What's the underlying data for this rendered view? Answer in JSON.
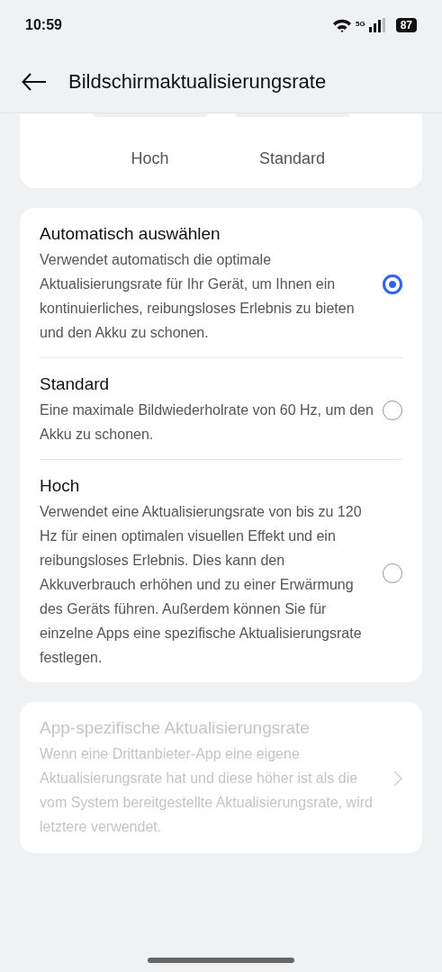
{
  "status_bar": {
    "time": "10:59",
    "network": "5G",
    "battery": "87"
  },
  "header": {
    "title": "Bildschirmaktualisierungsrate"
  },
  "preview": {
    "labels": [
      "Hoch",
      "Standard"
    ]
  },
  "options": [
    {
      "title": "Automatisch auswählen",
      "description": "Verwendet automatisch die optimale Aktualisierungsrate für Ihr Gerät, um Ihnen ein kontinuierliches, reibungsloses Erlebnis zu bieten und den Akku zu schonen.",
      "selected": true
    },
    {
      "title": "Standard",
      "description": "Eine maximale Bildwiederholrate von 60 Hz, um den Akku zu schonen.",
      "selected": false
    },
    {
      "title": "Hoch",
      "description": "Verwendet eine Aktualisierungsrate von bis zu 120 Hz für einen optimalen visuellen Effekt und ein reibungsloses Erlebnis. Dies kann den Akkuverbrauch erhöhen und zu einer Erwärmung des Geräts führen. Außerdem können Sie für einzelne Apps eine spezifische Aktualisierungsrate festlegen.",
      "selected": false
    }
  ],
  "app_specific": {
    "title": "App-spezifische Aktualisierungsrate",
    "description": "Wenn eine Drittanbieter-App eine eigene Aktualisierungsrate hat und diese höher ist als die vom System bereitgestellte Aktualisierungsrate, wird letztere verwendet.",
    "disabled": true
  }
}
